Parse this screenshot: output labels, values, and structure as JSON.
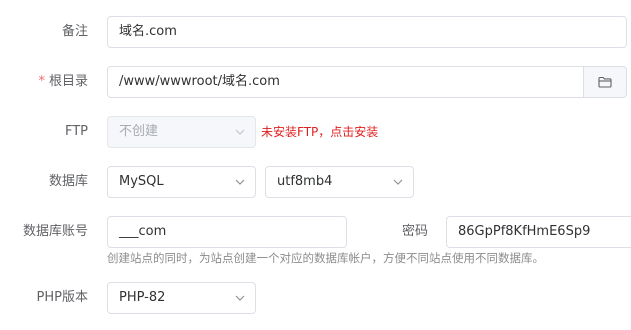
{
  "remark": {
    "label": "备注",
    "value": "域名.com"
  },
  "root_dir": {
    "required_mark": "*",
    "label": "根目录",
    "value": "/www/wwwroot/域名.com",
    "browse_icon": "folder-icon"
  },
  "ftp": {
    "label": "FTP",
    "selected": "不创建",
    "warning_link": "未安装FTP，点击安装"
  },
  "database": {
    "label": "数据库",
    "type_selected": "MySQL",
    "charset_selected": "utf8mb4"
  },
  "db_account": {
    "label": "数据库账号",
    "value": "___com",
    "password_label": "密码",
    "password_value": "86GpPf8KfHmE6Sp9",
    "hint": "创建站点的同时，为站点创建一个对应的数据库帐户，方便不同站点使用不同数据库。"
  },
  "php": {
    "label": "PHP版本",
    "selected": "PHP-82"
  },
  "colors": {
    "warning": "#e02020",
    "required": "#f56c6c",
    "border": "#dcdfe6"
  }
}
